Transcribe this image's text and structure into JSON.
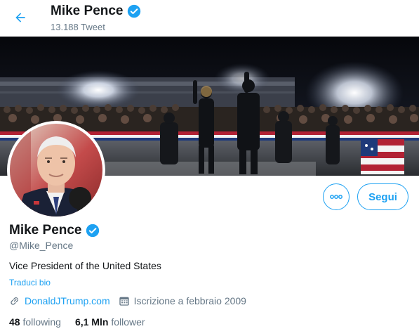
{
  "header": {
    "name": "Mike Pence",
    "tweet_count": "13.188 Tweet"
  },
  "actions": {
    "more_label": "",
    "follow_label": "Segui"
  },
  "profile": {
    "name": "Mike Pence",
    "handle": "@Mike_Pence",
    "bio": "Vice President of the United States",
    "translate_label": "Traduci bio",
    "website": "DonaldJTrump.com",
    "joined": "Iscrizione a febbraio 2009"
  },
  "stats": {
    "following_count": "48",
    "following_label": "following",
    "followers_count": "6,1 Mln",
    "followers_label": "follower"
  },
  "colors": {
    "accent": "#1da1f2",
    "secondary_text": "#657786",
    "primary_text": "#14171a"
  },
  "icons": [
    "back-arrow-icon",
    "verified-badge-icon",
    "more-icon",
    "link-icon",
    "calendar-icon"
  ]
}
